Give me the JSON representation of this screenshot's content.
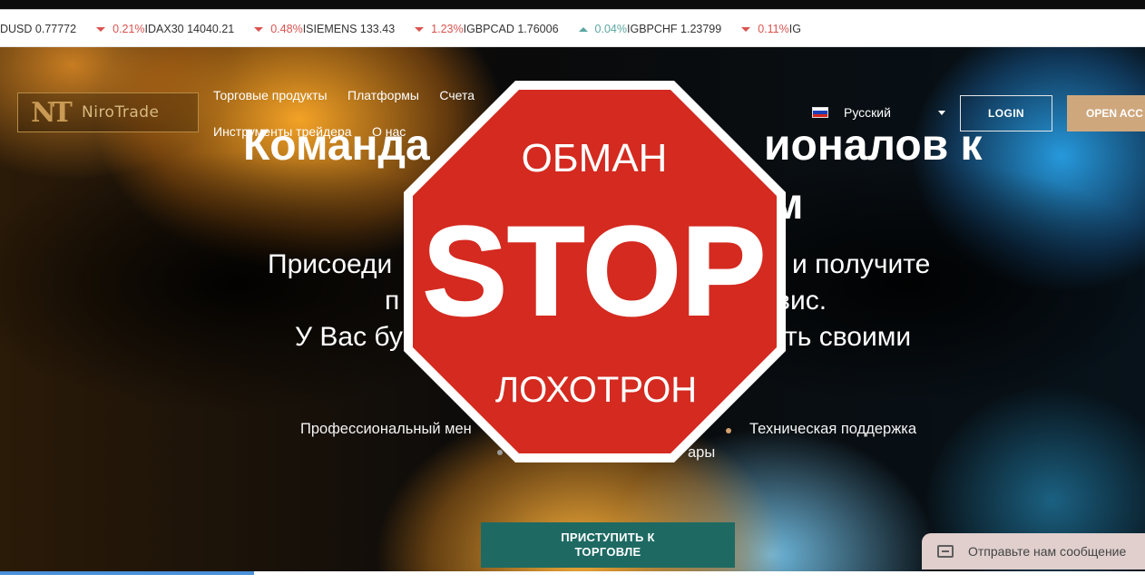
{
  "ticker": [
    {
      "symbol": "DUSD 0.77772",
      "change": "0.21%",
      "direction": "down"
    },
    {
      "symbol": "DAX30 14040.21",
      "change": "0.48%",
      "direction": "down"
    },
    {
      "symbol": "SIEMENS 133.43",
      "change": "1.23%",
      "direction": "down"
    },
    {
      "symbol": "GBPCAD 1.76006",
      "change": "0.04%",
      "direction": "up"
    },
    {
      "symbol": "GBPCHF 1.23799",
      "change": "0.11%",
      "direction": "down"
    },
    {
      "symbol": "G",
      "change": "",
      "direction": ""
    }
  ],
  "ticker_separator": "I",
  "logo": {
    "mark": "NT",
    "text": "NiroTrade"
  },
  "nav": {
    "trading_products": "Торговые продукты",
    "platforms": "Платформы",
    "accounts": "Счета",
    "trader_tools": "Инструменты трейдера",
    "about": "О нас"
  },
  "language": {
    "label": "Русский"
  },
  "buttons": {
    "login": "LOGIN",
    "open_account": "OPEN ACC",
    "cta_line1": "ПРИСТУПИТЬ К",
    "cta_line2": "ТОРГОВЛЕ"
  },
  "hero": {
    "heading_line1_left": "Команда",
    "heading_line1_right": "ионалов к",
    "heading_line2": "м",
    "sub_line1_left": "Присоеди",
    "sub_line1_right": "и получите",
    "sub_line2_left": "п",
    "sub_line2_right": "вис.",
    "sub_line3_left": "У Вас бу",
    "sub_line3_right": "ть своими"
  },
  "features": {
    "manager_partial": "Профессиональный мен",
    "support": "Техническая поддержка",
    "second_row_partial": "ары"
  },
  "chat": {
    "label": "Отправьте нам сообщение"
  },
  "stop_sign": {
    "top_text": "ОБМАН",
    "main_text": "STOP",
    "bottom_text": "ЛОХОТРОН"
  },
  "colors": {
    "accent_gold": "#cfa77d",
    "cta_teal": "#1e6a63",
    "stop_red": "#d42a20",
    "ticker_down": "#d9534f",
    "ticker_up": "#5aa6a0"
  }
}
